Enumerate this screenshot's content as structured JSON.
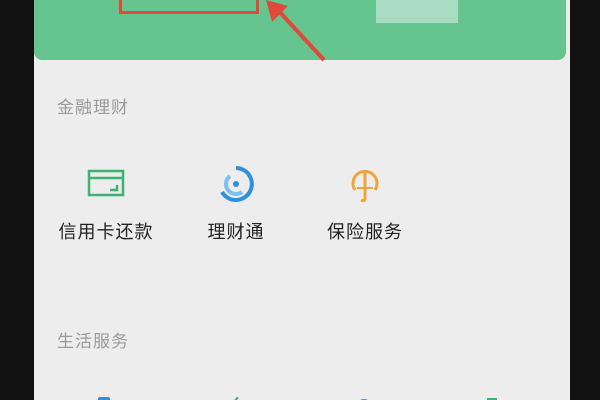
{
  "colors": {
    "wallet_green": "#66c48f",
    "highlight_red": "#e14a3a",
    "background": "#ededed",
    "icon_teal": "#3cb371",
    "icon_blue": "#2f8fe0",
    "icon_orange": "#f0a43a"
  },
  "wallet_card": {
    "highlight": "annotation-rectangle"
  },
  "finance": {
    "title": "金融理财",
    "items": [
      {
        "label": "信用卡还款",
        "icon": "credit-card-icon"
      },
      {
        "label": "理财通",
        "icon": "wealth-management-icon"
      },
      {
        "label": "保险服务",
        "icon": "insurance-icon"
      }
    ]
  },
  "life": {
    "title": "生活服务",
    "items": [
      {
        "icon": "phone-recharge-icon"
      },
      {
        "icon": "utilities-icon"
      },
      {
        "icon": "city-services-icon"
      },
      {
        "icon": "tencent-charity-icon"
      }
    ]
  }
}
